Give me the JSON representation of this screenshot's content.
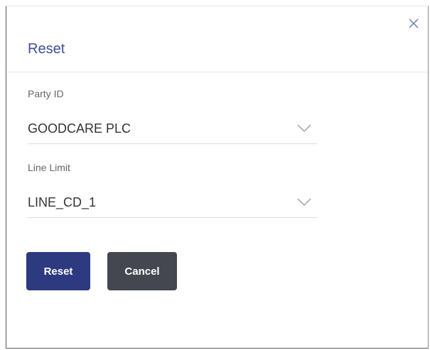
{
  "dialog": {
    "title": "Reset",
    "close_icon": "close-icon"
  },
  "fields": {
    "party": {
      "label": "Party ID",
      "value": "GOODCARE PLC",
      "icon": "chevron-down-icon"
    },
    "line_limit": {
      "label": "Line Limit",
      "value": "LINE_CD_1",
      "icon": "chevron-down-icon"
    }
  },
  "buttons": {
    "reset_label": "Reset",
    "cancel_label": "Cancel"
  },
  "colors": {
    "title": "#3d4f9e",
    "primary_button": "#2d3a80",
    "secondary_button": "#44474f"
  }
}
